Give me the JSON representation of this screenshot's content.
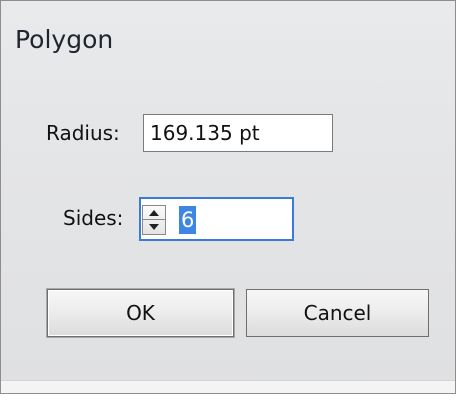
{
  "dialog": {
    "title": "Polygon"
  },
  "radius": {
    "label": "Radius:",
    "value": "169.135 pt"
  },
  "sides": {
    "label": "Sides:",
    "value": "6"
  },
  "buttons": {
    "ok_label": "OK",
    "cancel_label": "Cancel"
  },
  "colors": {
    "focus_border": "#3a7bd5",
    "selection": "#3d86e6"
  }
}
